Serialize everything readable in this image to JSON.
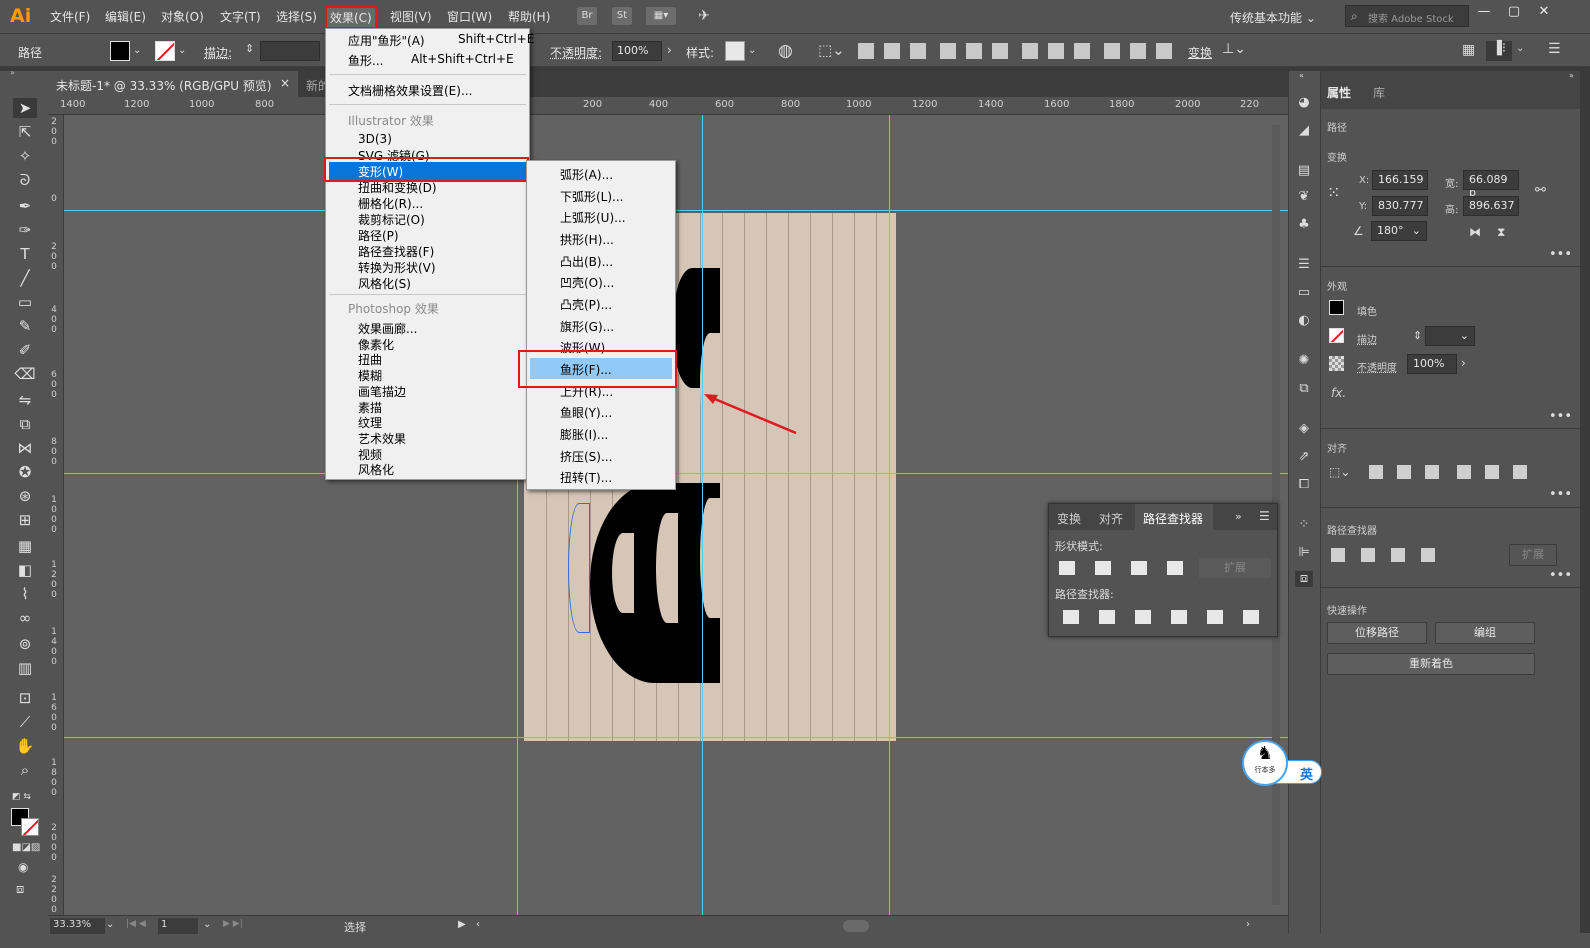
{
  "app": {
    "logo": "Ai"
  },
  "menubar": {
    "items": [
      "文件(F)",
      "编辑(E)",
      "对象(O)",
      "文字(T)",
      "选择(S)",
      "效果(C)",
      "视图(V)",
      "窗口(W)",
      "帮助(H)"
    ],
    "icons": {
      "br": "Br",
      "st": "St"
    },
    "workspace": "传统基本功能",
    "stock_placeholder": "搜索 Adobe Stock"
  },
  "control": {
    "object_type": "路径",
    "stroke_label": "描边:",
    "opacity_label": "不透明度:",
    "opacity_value": "100%",
    "style_label": "样式:",
    "transform_label": "变换"
  },
  "document": {
    "tab_title": "未标题-1* @ 33.33% (RGB/GPU 预览)",
    "tab_close": "×",
    "second_tab": "新的"
  },
  "ruler": {
    "top": [
      "1400",
      "1200",
      "1000",
      "800",
      "200",
      "400",
      "600",
      "800",
      "1000",
      "1200",
      "1400",
      "1600",
      "1800",
      "2000",
      "220"
    ],
    "left": [
      "2\n0\n0",
      "0",
      "2\n0\n0",
      "4\n0\n0",
      "6\n0\n0",
      "8\n0\n0",
      "1\n0\n0\n0",
      "1\n2\n0\n0",
      "1\n4\n0\n0",
      "1\n6\n0\n0",
      "1\n8\n0\n0",
      "2\n0\n0\n0",
      "2\n2\n0\n0"
    ]
  },
  "effect_menu": {
    "apply_label": "应用\"鱼形\"(A)",
    "apply_shortcut": "Shift+Ctrl+E",
    "last_label": "鱼形...",
    "last_shortcut": "Alt+Shift+Ctrl+E",
    "raster_settings": "文档栅格效果设置(E)...",
    "illustrator_header": "Illustrator 效果",
    "illustrator_items": [
      "3D(3)",
      "SVG 滤镜(G)",
      "变形(W)",
      "扭曲和变换(D)",
      "栅格化(R)...",
      "裁剪标记(O)",
      "路径(P)",
      "路径查找器(F)",
      "转换为形状(V)",
      "风格化(S)"
    ],
    "photoshop_header": "Photoshop 效果",
    "photoshop_items": [
      "效果画廊...",
      "像素化",
      "扭曲",
      "模糊",
      "画笔描边",
      "素描",
      "纹理",
      "艺术效果",
      "视频",
      "风格化"
    ]
  },
  "warp_menu": {
    "items": [
      "弧形(A)...",
      "下弧形(L)...",
      "上弧形(U)...",
      "拱形(H)...",
      "凸出(B)...",
      "凹壳(O)...",
      "凸壳(P)...",
      "旗形(G)...",
      "波形(W)...",
      "鱼形(F)...",
      "上升(R)...",
      "鱼眼(Y)...",
      "膨胀(I)...",
      "挤压(S)...",
      "扭转(T)..."
    ],
    "selected": "鱼形(F)..."
  },
  "pathfinder": {
    "tabs": [
      "变换",
      "对齐",
      "路径查找器"
    ],
    "shape_modes": "形状模式:",
    "expand": "扩展",
    "pathfinders": "路径查找器:"
  },
  "properties": {
    "tabs": [
      "属性",
      "库"
    ],
    "object_type": "路径",
    "transform": "变换",
    "x_label": "X:",
    "x": "166.159",
    "y_label": "Y:",
    "y": "830.777",
    "w_label": "宽:",
    "w": "66.089 p",
    "h_label": "高:",
    "h": "896.637",
    "angle": "180°",
    "appearance": "外观",
    "fill": "填色",
    "stroke": "描边",
    "opacity_label": "不透明度",
    "opacity": "100%",
    "fx": "fx.",
    "align": "对齐",
    "pathfinder": "路径查找器",
    "expand": "扩展",
    "quick_actions": "快速操作",
    "offset_path": "位移路径",
    "group": "编组",
    "recolor": "重新着色"
  },
  "status": {
    "zoom": "33.33%",
    "page": "1",
    "tool": "选择"
  },
  "badge": {
    "ime": "英",
    "seal_text": "行本多"
  },
  "colors": {
    "accent": "#0a74d9",
    "highlight": "#91c9f7",
    "annotation": "#e0191e",
    "guide": "#46d4e0",
    "artboard": "#d5c6b8"
  }
}
